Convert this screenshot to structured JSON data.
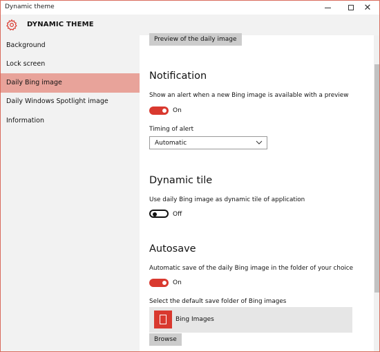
{
  "window": {
    "title": "Dynamic theme"
  },
  "header": {
    "app_title": "DYNAMIC THEME",
    "icon": "gear-icon",
    "accent": "#d9392f"
  },
  "sidebar": {
    "items": [
      {
        "label": "Background",
        "selected": false
      },
      {
        "label": "Lock screen",
        "selected": false
      },
      {
        "label": "Daily Bing image",
        "selected": true
      },
      {
        "label": "Daily Windows Spotlight image",
        "selected": false
      },
      {
        "label": "Information",
        "selected": false
      }
    ],
    "selected_color": "#e8a39a"
  },
  "main": {
    "preview_button": "Preview of the daily image",
    "notification": {
      "title": "Notification",
      "description": "Show an alert when a new Bing image is available with a preview",
      "toggle_state": "On",
      "timing_label": "Timing of alert",
      "timing_value": "Automatic"
    },
    "dynamic_tile": {
      "title": "Dynamic tile",
      "description": "Use daily Bing image as dynamic tile of application",
      "toggle_state": "Off"
    },
    "autosave": {
      "title": "Autosave",
      "description": "Automatic save of the daily Bing image in the folder of your choice",
      "toggle_state": "On",
      "folder_label": "Select the default save folder of Bing images",
      "folder_name": "Bing Images",
      "browse_button": "Browse"
    }
  }
}
